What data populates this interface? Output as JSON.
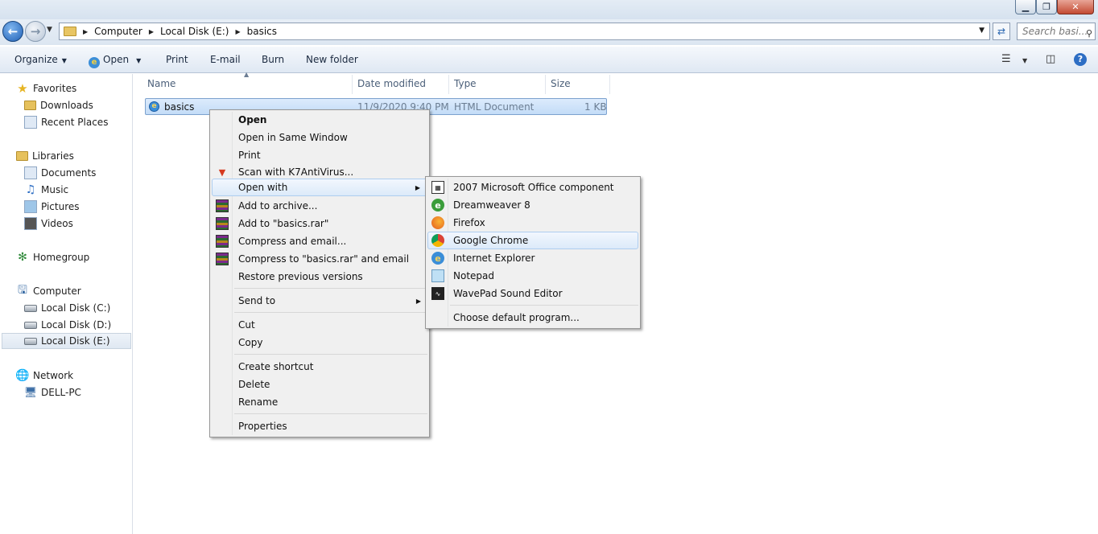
{
  "window": {
    "title": "",
    "controls": {
      "minimize": "▁",
      "maximize": "❐",
      "close": "✕"
    }
  },
  "address": {
    "crumbs": [
      "Computer",
      "Local Disk (E:)",
      "basics"
    ],
    "search_placeholder": "Search basi..."
  },
  "toolbar": {
    "organize": "Organize",
    "open": "Open",
    "print": "Print",
    "email": "E-mail",
    "burn": "Burn",
    "new_folder": "New folder"
  },
  "nav": {
    "favorites": "Favorites",
    "downloads": "Downloads",
    "recent_places": "Recent Places",
    "libraries": "Libraries",
    "documents": "Documents",
    "music": "Music",
    "pictures": "Pictures",
    "videos": "Videos",
    "homegroup": "Homegroup",
    "computer": "Computer",
    "disk_c": "Local Disk (C:)",
    "disk_d": "Local Disk (D:)",
    "disk_e": "Local Disk (E:)",
    "network": "Network",
    "dell_pc": "DELL-PC"
  },
  "columns": {
    "name": "Name",
    "date_modified": "Date modified",
    "type": "Type",
    "size": "Size"
  },
  "file": {
    "name": "basics",
    "date_modified": "11/9/2020 9:40 PM",
    "type": "HTML Document",
    "size": "1 KB"
  },
  "context_menu": {
    "open": "Open",
    "open_same_window": "Open in Same Window",
    "print": "Print",
    "scan": "Scan with K7AntiVirus...",
    "open_with": "Open with",
    "add_archive": "Add to archive...",
    "add_rar": "Add to \"basics.rar\"",
    "compress_email": "Compress and email...",
    "compress_rar_email": "Compress to \"basics.rar\" and email",
    "restore": "Restore previous versions",
    "send_to": "Send to",
    "cut": "Cut",
    "copy": "Copy",
    "create_shortcut": "Create shortcut",
    "delete": "Delete",
    "rename": "Rename",
    "properties": "Properties"
  },
  "open_with_menu": {
    "office": "2007 Microsoft Office component",
    "dreamweaver": "Dreamweaver 8",
    "firefox": "Firefox",
    "chrome": "Google Chrome",
    "ie": "Internet Explorer",
    "notepad": "Notepad",
    "wavepad": "WavePad Sound Editor",
    "choose_default": "Choose default program..."
  }
}
